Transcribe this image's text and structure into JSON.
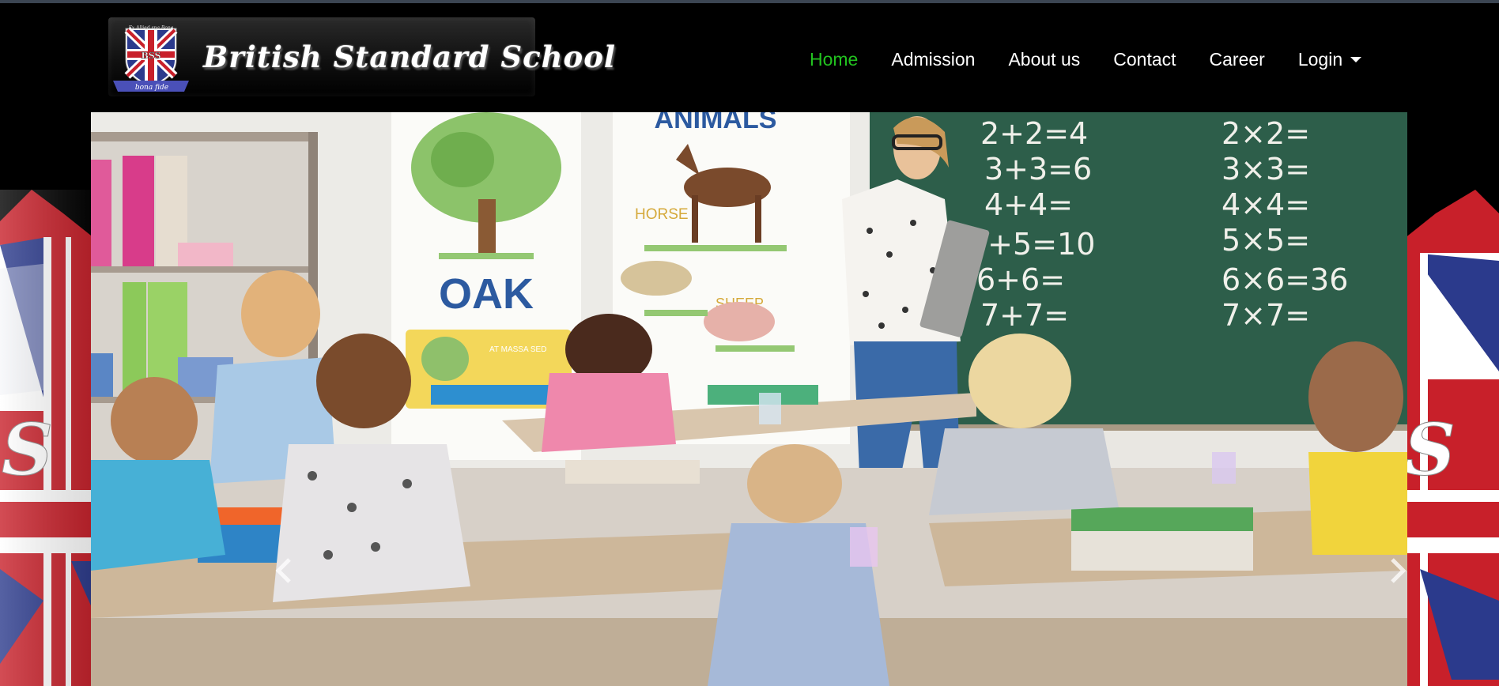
{
  "brand": {
    "name": "British Standard School",
    "crest_motto": "Fx Allied sna Bona",
    "crest_ribbon": "bona fide",
    "crest_initials": "BSS"
  },
  "nav": {
    "items": [
      {
        "label": "Home",
        "active": true
      },
      {
        "label": "Admission",
        "active": false
      },
      {
        "label": "About us",
        "active": false
      },
      {
        "label": "Contact",
        "active": false
      },
      {
        "label": "Career",
        "active": false
      }
    ],
    "login_label": "Login"
  },
  "hero": {
    "poster_oak_title": "OAK",
    "poster_oak_caption": "AT MASSA SED",
    "poster_animals_title": "ANIMALS",
    "poster_horse": "HORSE",
    "poster_sheep": "SHEEP",
    "board_col1": [
      "2+2=4",
      "3+3=6",
      "4+4=",
      "5+5=10",
      "6+6=",
      "7+7="
    ],
    "board_col2": [
      "2×2=",
      "3×3=",
      "4×4=",
      "5×5=",
      "6×6=36",
      "7×7="
    ]
  },
  "colors": {
    "active_nav": "#22c21f",
    "flag_red": "#c8202a",
    "flag_blue": "#2b3a8c",
    "chalkboard": "#2d5e4a"
  }
}
